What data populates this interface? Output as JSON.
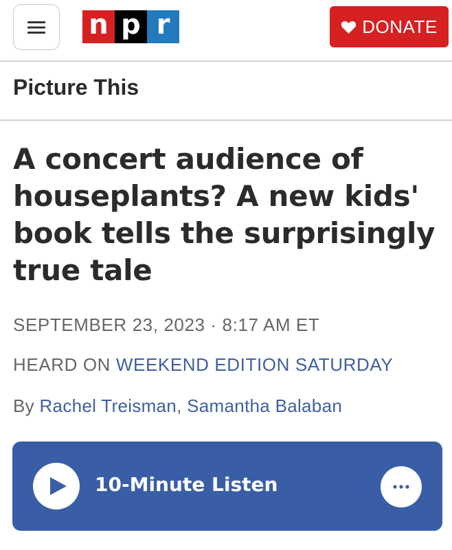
{
  "header": {
    "menu_icon": "hamburger-menu-icon",
    "logo": {
      "letters": [
        "n",
        "p",
        "r"
      ],
      "colors": [
        "#d62021",
        "#000000",
        "#237bbd"
      ]
    },
    "donate_label": "DONATE",
    "donate_icon": "heart-icon",
    "donate_color": "#d62021"
  },
  "section": {
    "title": "Picture This"
  },
  "article": {
    "headline": "A concert audience of houseplants? A new kids' book tells the surprisingly true tale",
    "date": "SEPTEMBER 23, 2023 · 8:17 AM ET",
    "heard_on_prefix": "HEARD ON",
    "heard_on_show": "WEEKEND EDITION SATURDAY",
    "byline_prefix": "By",
    "authors": [
      "Rachel Treisman",
      "Samantha Balaban"
    ],
    "author_separator": ","
  },
  "player": {
    "label": "10-Minute Listen",
    "play_icon": "play-icon",
    "more_icon": "more-options-icon",
    "background_color": "#3a5ea6"
  }
}
